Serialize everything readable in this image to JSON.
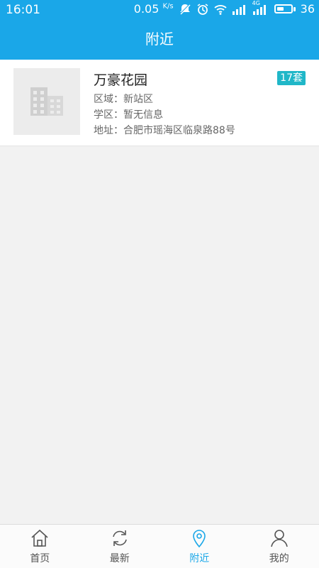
{
  "status_bar": {
    "time": "16:01",
    "speed_value": "0.05",
    "speed_unit": "K/s",
    "network_label": "4G",
    "battery": "36"
  },
  "header": {
    "title": "附近"
  },
  "listing": {
    "name": "万豪花园",
    "badge": "17套",
    "area": "区域：新站区",
    "school": "学区：暂无信息",
    "address": "地址：合肥市瑶海区临泉路88号"
  },
  "tabs": [
    {
      "label": "首页",
      "icon": "home-icon"
    },
    {
      "label": "最新",
      "icon": "refresh-icon"
    },
    {
      "label": "附近",
      "icon": "location-pin-icon",
      "active": true
    },
    {
      "label": "我的",
      "icon": "person-icon"
    }
  ],
  "colors": {
    "accent": "#1aa7e8",
    "badge": "#20b7c8"
  }
}
